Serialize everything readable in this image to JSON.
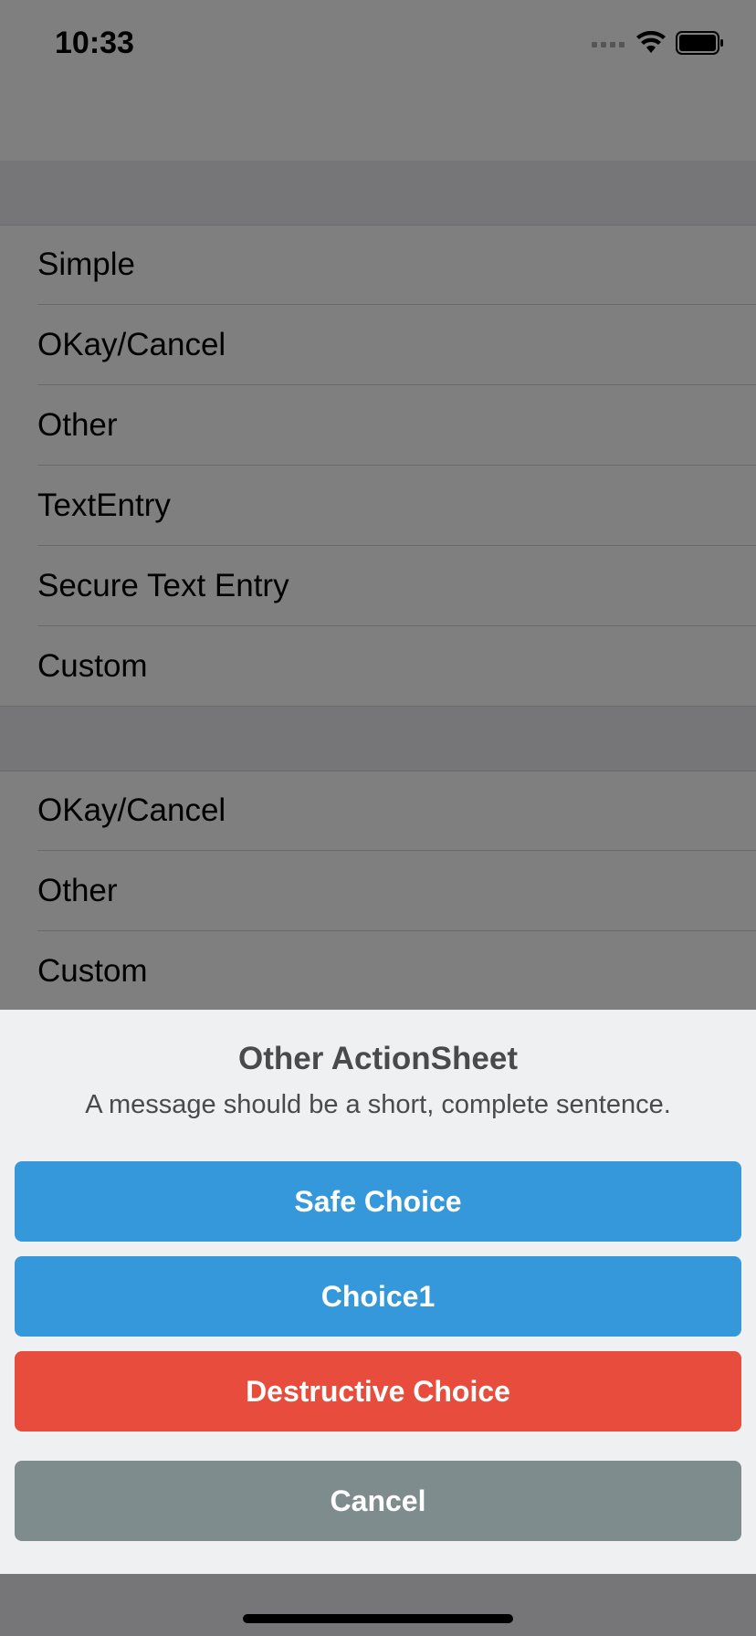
{
  "status_bar": {
    "time": "10:33",
    "icons": [
      "cellular-signal-icon",
      "wifi-icon",
      "battery-icon"
    ]
  },
  "table": {
    "section1": [
      "Simple",
      "OKay/Cancel",
      "Other",
      "TextEntry",
      "Secure Text Entry",
      "Custom"
    ],
    "section2": [
      "OKay/Cancel",
      "Other",
      "Custom"
    ]
  },
  "action_sheet": {
    "title": "Other ActionSheet",
    "message": "A message should be a short, complete sentence.",
    "buttons": {
      "safe": "Safe Choice",
      "choice1": "Choice1",
      "destructive": "Destructive Choice",
      "cancel": "Cancel"
    }
  },
  "colors": {
    "overlay": "#7f7f7f",
    "sheet_background": "#eff0f2",
    "safe_button": "#3598db",
    "destructive_button": "#e74c3c",
    "cancel_button": "#7f8c8d"
  }
}
